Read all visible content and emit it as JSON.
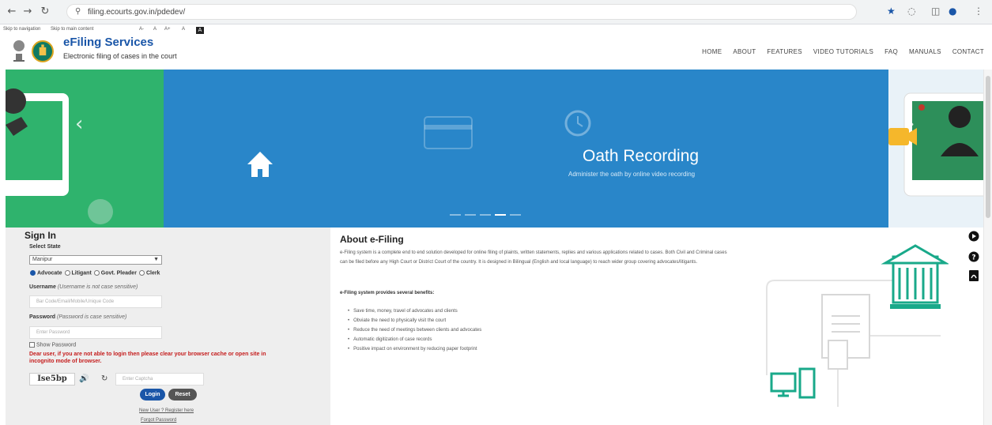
{
  "browser": {
    "url": "filing.ecourts.gov.in/pdedev/",
    "back_icon": "arrow-left-icon",
    "forward_icon": "arrow-right-icon",
    "reload_icon": "reload-icon"
  },
  "accessibility": {
    "skip_navigation": "Skip to navigation",
    "skip_main": "Skip to main content",
    "font_small": "A-",
    "font_normal": "A",
    "font_large": "A+",
    "contrast_light": "A",
    "contrast_dark": "A"
  },
  "header": {
    "brand": "eFiling Services",
    "tagline": "Electronic filing of cases in the court",
    "menu": [
      "HOME",
      "ABOUT",
      "FEATURES",
      "VIDEO TUTORIALS",
      "FAQ",
      "MANUALS",
      "CONTACT"
    ]
  },
  "hero": {
    "title": "Oath Recording",
    "subtitle": "Administer the oath by online video recording",
    "prev_arrow": "‹",
    "next_arrow": "›",
    "slides": 5,
    "active_slide": 4,
    "colors": {
      "blue": "#2986c9",
      "green": "#2fb36d"
    }
  },
  "signin": {
    "title": "Sign In",
    "state_label": "Select State",
    "state_value": "Manipur",
    "roles": [
      "Advocate",
      "Litigant",
      "Govt. Pleader",
      "Clerk"
    ],
    "selected_role": "Advocate",
    "username_label": "Username",
    "username_hint": "(Username is not case sensitive)",
    "username_placeholder": "Bar Code/Email/Mobile/Unique Code",
    "password_label": "Password",
    "password_hint": "(Password is case sensitive)",
    "password_placeholder": "Enter Password",
    "show_password": "Show Password",
    "warning": "Dear user, if you are not able to login then please clear your browser cache or open site in incognito mode of browser.",
    "captcha_code": "Ise5bp",
    "captcha_placeholder": "Enter Captcha",
    "login": "Login",
    "reset": "Reset",
    "register": "New User ? Register here",
    "forgot": "Forgot Password"
  },
  "about": {
    "title": "About e-Filing",
    "paragraph": "e-Filing system is a complete end to end solution developed for online filing of plaints, written statements, replies and various applications related to cases. Both Civil and Criminal cases can be filed before any High Court or District Court of the country. It is designed in Bilingual (English and local language) to reach wider group covering advocates/litigants.",
    "benefits_title": "e-Filing system provides several benefits:",
    "benefits": [
      "Save time, money, travel of advocates and clients",
      "Obviate the need to physically visit the court",
      "Reduce the need of meetings between clients and advocates",
      "Automatic digitization of case records",
      "Positive impact on environment by reducing paper footprint"
    ]
  },
  "accent": {
    "brand_blue": "#1a56a8",
    "warning_red": "#c51d1d",
    "court_green": "#19a98a"
  }
}
